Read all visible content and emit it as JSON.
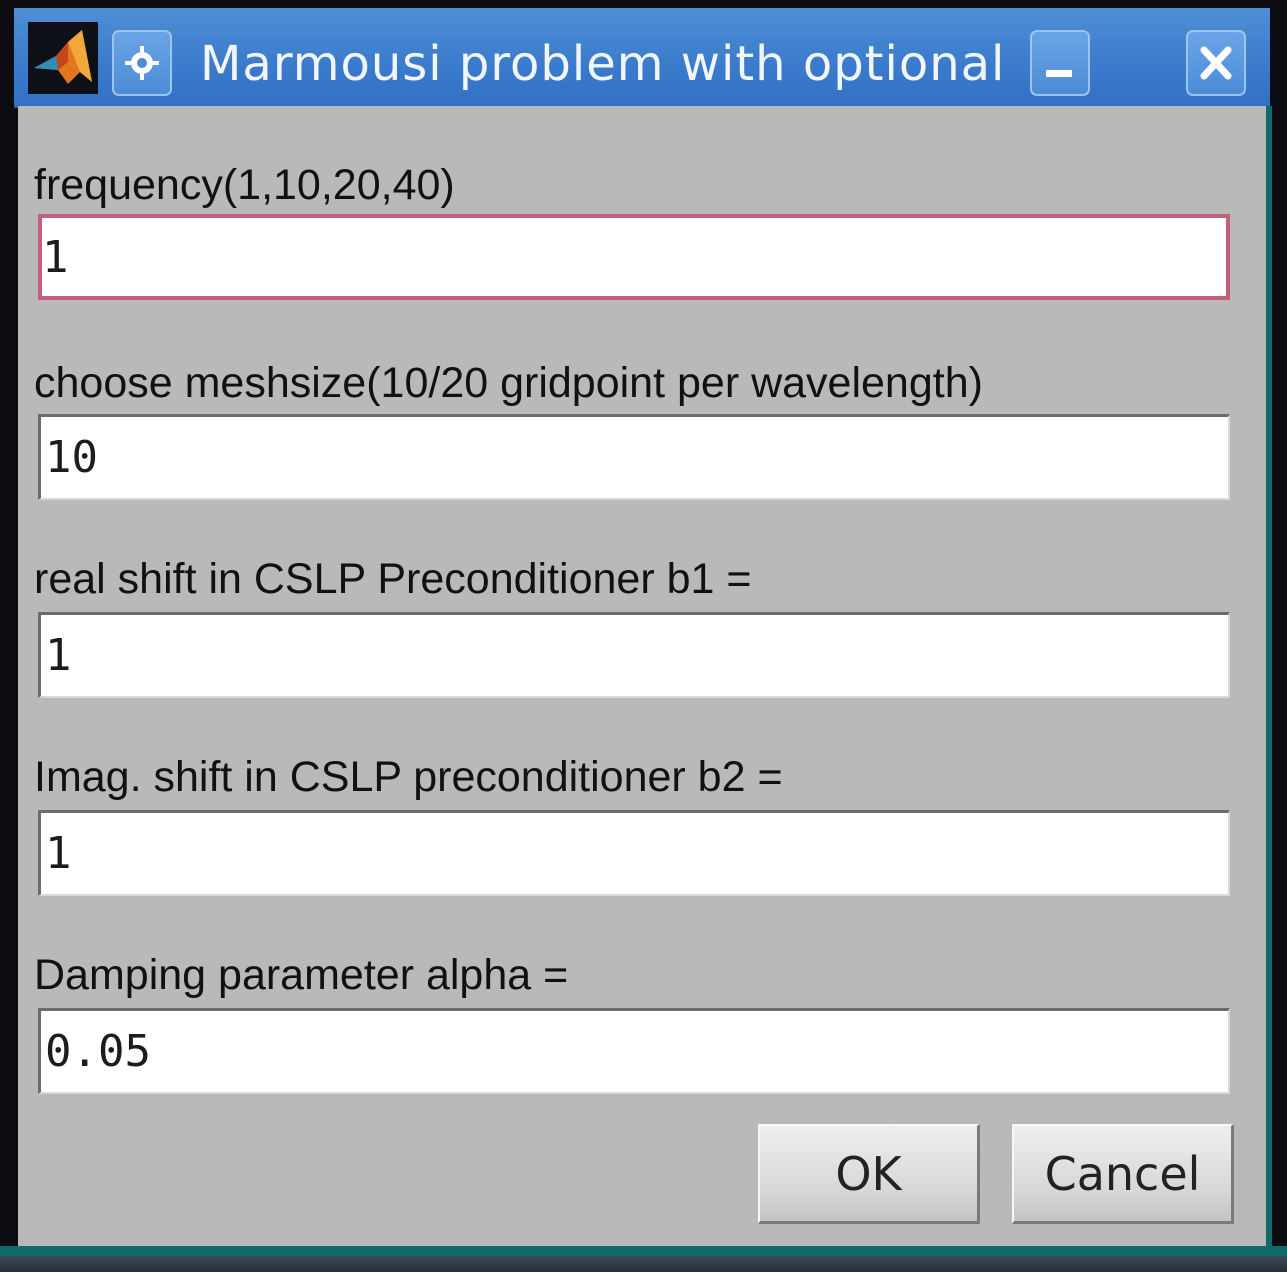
{
  "window": {
    "title": "Marmousi problem with optional"
  },
  "fields": [
    {
      "label": "frequency(1,10,20,40)",
      "value": "1"
    },
    {
      "label": "choose meshsize(10/20 gridpoint per wavelength)",
      "value": "10"
    },
    {
      "label": "real shift in CSLP Preconditioner b1 =",
      "value": "1"
    },
    {
      "label": "Imag. shift in CSLP preconditioner b2 =",
      "value": "1"
    },
    {
      "label": "Damping parameter alpha =",
      "value": "0.05"
    }
  ],
  "buttons": {
    "ok": "OK",
    "cancel": "Cancel"
  },
  "icons": {
    "app": "matlab-logo-icon",
    "menu": "window-menu-icon",
    "minimize": "minimize-icon",
    "close": "close-icon"
  },
  "colors": {
    "titlebar": "#3b7ccd",
    "dialog_background": "#b9b9b9",
    "focus_border": "#c2607a",
    "selection": "#3d6fc8"
  }
}
